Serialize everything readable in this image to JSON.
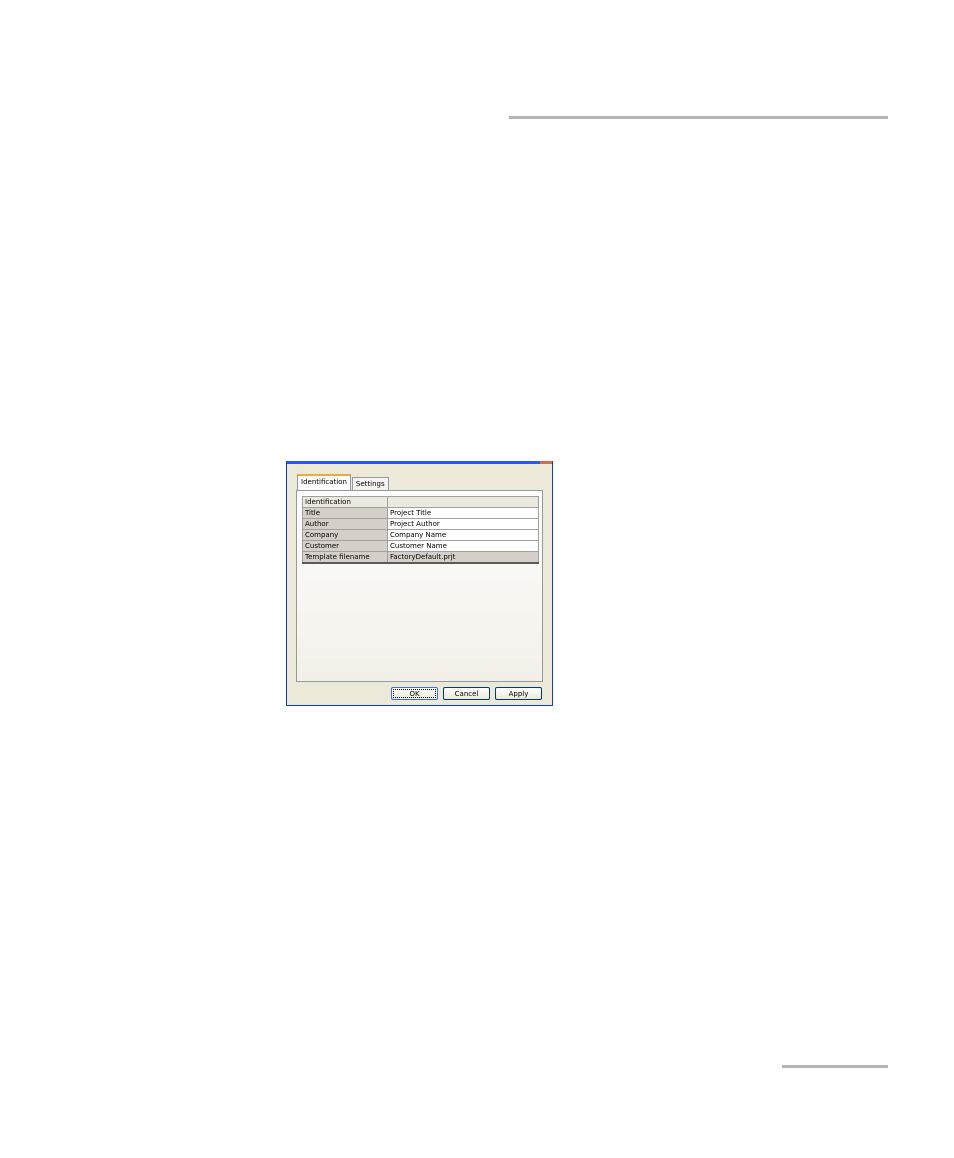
{
  "dialog": {
    "tabs": [
      {
        "label": "Identification",
        "active": true
      },
      {
        "label": "Settings",
        "active": false
      }
    ],
    "table": {
      "header": {
        "key": "Identification",
        "value": ""
      },
      "rows": [
        {
          "key": "Title",
          "value": "Project Title"
        },
        {
          "key": "Author",
          "value": "Project Author"
        },
        {
          "key": "Company",
          "value": "Company Name"
        },
        {
          "key": "Customer",
          "value": "Customer Name"
        },
        {
          "key": "Template filename",
          "value": "FactoryDefault.prjt"
        }
      ]
    },
    "buttons": {
      "ok": "OK",
      "cancel": "Cancel",
      "apply": "Apply"
    }
  },
  "colors": {
    "window_border": "#0a3fc0",
    "dialog_bg": "#ece9d8",
    "active_tab_accent": "#f1a83c",
    "page_rule": "#b5b5b5"
  }
}
